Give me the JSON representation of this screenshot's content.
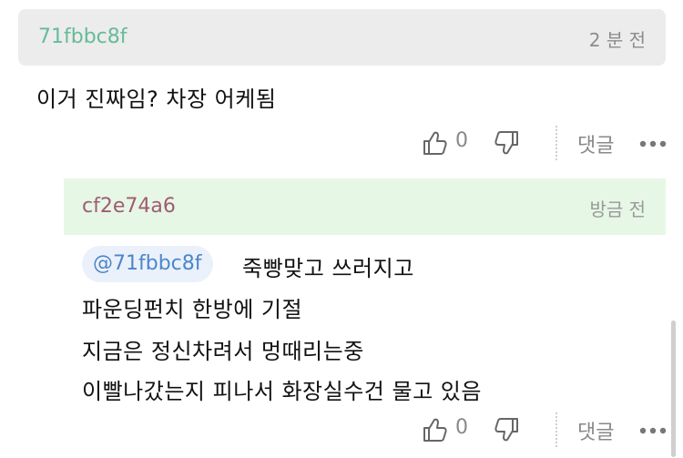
{
  "comment": {
    "username": "71fbbc8f",
    "time": "2 분 전",
    "text": "이거 진짜임? 차장 어케됨",
    "likes": "0",
    "reply_label": "댓글"
  },
  "reply": {
    "username": "cf2e74a6",
    "time": "방금 전",
    "mention": "@71fbbc8f",
    "lines": [
      "죽빵맞고 쓰러지고",
      "파운딩펀치 한방에 기절",
      "지금은 정신차려서 멍때리는중",
      "이빨나갔는지 피나서 화장실수건 물고 있음"
    ],
    "likes": "0",
    "reply_label": "댓글"
  },
  "icons": {
    "like": "thumbs-up-icon",
    "dislike": "thumbs-down-icon",
    "more": "more-dots-icon"
  },
  "colors": {
    "comment_header_bg": "#ececec",
    "reply_header_bg": "#e6f7e6",
    "comment_username": "#66bb99",
    "reply_username": "#a05c72",
    "mention_text": "#4d86c8",
    "mention_bg": "#eaf1fb"
  }
}
